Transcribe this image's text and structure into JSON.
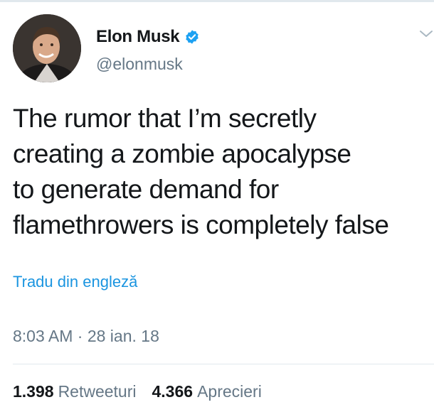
{
  "author": {
    "display_name": "Elon Musk",
    "handle": "@elonmusk",
    "verified": true,
    "avatar_icon": "avatar-photo"
  },
  "tweet": {
    "text_lines": [
      "The rumor that I’m secretly",
      "creating a zombie apocalypse",
      "to generate demand for",
      "flamethrowers is completely false"
    ],
    "translate_link": "Tradu din engleză",
    "timestamp": "8:03 AM · 28 ian. 18"
  },
  "stats": {
    "retweets_count": "1.398",
    "retweets_label": "Retweeturi",
    "likes_count": "4.366",
    "likes_label": "Aprecieri"
  },
  "colors": {
    "link": "#1b95e0",
    "verified_badge": "#1da1f2",
    "secondary_text": "#657786",
    "primary_text": "#14171a"
  }
}
